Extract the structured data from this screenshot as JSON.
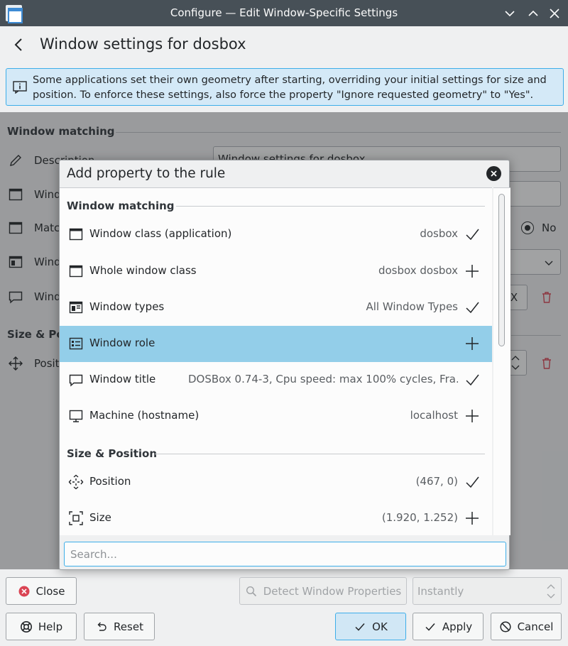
{
  "window": {
    "title": "Configure — Edit Window-Specific Settings"
  },
  "header": {
    "title": "Window settings for dosbox"
  },
  "info_banner": {
    "text": "Some applications set their own geometry after starting, overriding your initial settings for size and position. To enforce these settings, also force the property \"Ignore requested geometry\" to \"Yes\"."
  },
  "background": {
    "section_matching": "Window matching",
    "section_size": "Size & Po",
    "rows": [
      {
        "label": "Description",
        "value": "Window settings for dosbox"
      },
      {
        "label": "Wind"
      },
      {
        "label": "Matc"
      },
      {
        "label": "Wind"
      },
      {
        "label": "Wind"
      },
      {
        "label": "Positi"
      }
    ],
    "radio_no_label": "No",
    "field_fragment": "OX"
  },
  "dialog": {
    "title": "Add property to the rule",
    "section_matching": "Window matching",
    "section_size": "Size & Position",
    "properties": [
      {
        "icon": "window-icon",
        "label": "Window class (application)",
        "value": "dosbox",
        "action": "check"
      },
      {
        "icon": "window-icon",
        "label": "Whole window class",
        "value": "dosbox dosbox",
        "action": "plus"
      },
      {
        "icon": "window-types-icon",
        "label": "Window types",
        "value": "All Window Types",
        "action": "check"
      },
      {
        "icon": "window-role-icon",
        "label": "Window role",
        "value": "",
        "action": "plus",
        "selected": true
      },
      {
        "icon": "window-title-icon",
        "label": "Window title",
        "value": "DOSBox 0.74-3, Cpu speed: max 100% cycles, Fra...",
        "action": "check"
      },
      {
        "icon": "monitor-icon",
        "label": "Machine (hostname)",
        "value": "localhost",
        "action": "plus"
      },
      {
        "icon": "move-icon",
        "label": "Position",
        "value": "(467, 0)",
        "action": "check"
      },
      {
        "icon": "resize-icon",
        "label": "Size",
        "value": "(1.920, 1.252)",
        "action": "plus"
      }
    ],
    "search_placeholder": "Search..."
  },
  "buttons": {
    "close": "Close",
    "detect": "Detect Window Properties",
    "delay": "Instantly",
    "help": "Help",
    "reset": "Reset",
    "ok": "OK",
    "apply": "Apply",
    "cancel": "Cancel"
  },
  "colors": {
    "titlebar": "#475057",
    "selection": "#93cee9",
    "accent": "#3daee9",
    "danger": "#da4453"
  }
}
